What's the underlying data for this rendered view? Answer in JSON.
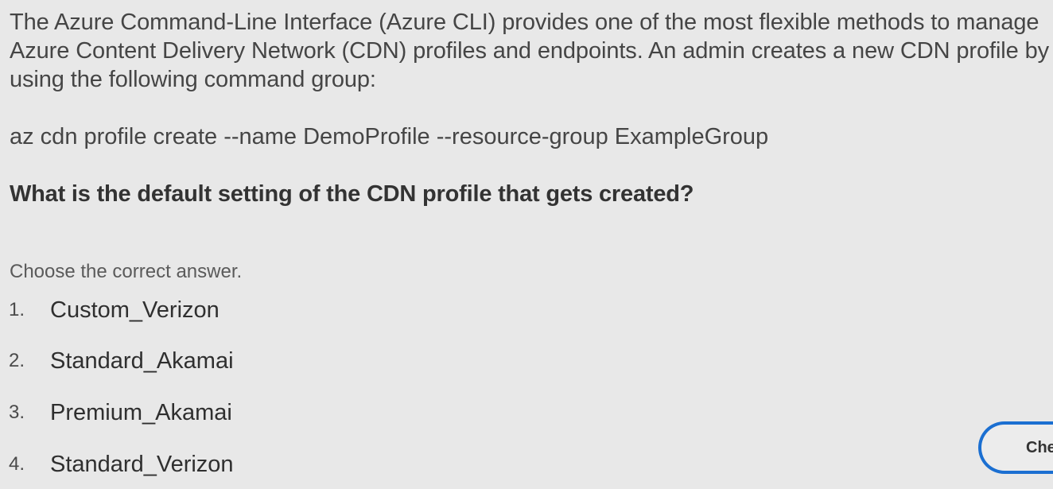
{
  "question": {
    "intro_lines": [
      "The Azure Command-Line Interface (Azure CLI) provides one of the most flexible methods to manage",
      "Azure Content Delivery Network (CDN) profiles and endpoints. An admin creates a new CDN profile by",
      "using the following command group:"
    ],
    "command": "az cdn profile create --name DemoProfile --resource-group ExampleGroup",
    "prompt": "What is the default setting of the CDN profile that gets created?",
    "instruction": "Choose the correct answer."
  },
  "answers": [
    {
      "number": "1.",
      "label": "Custom_Verizon"
    },
    {
      "number": "2.",
      "label": "Standard_Akamai"
    },
    {
      "number": "3.",
      "label": "Premium_Akamai"
    },
    {
      "number": "4.",
      "label": "Standard_Verizon"
    }
  ],
  "check_button": {
    "label": "Che",
    "accent_color": "#1b6fd1"
  }
}
